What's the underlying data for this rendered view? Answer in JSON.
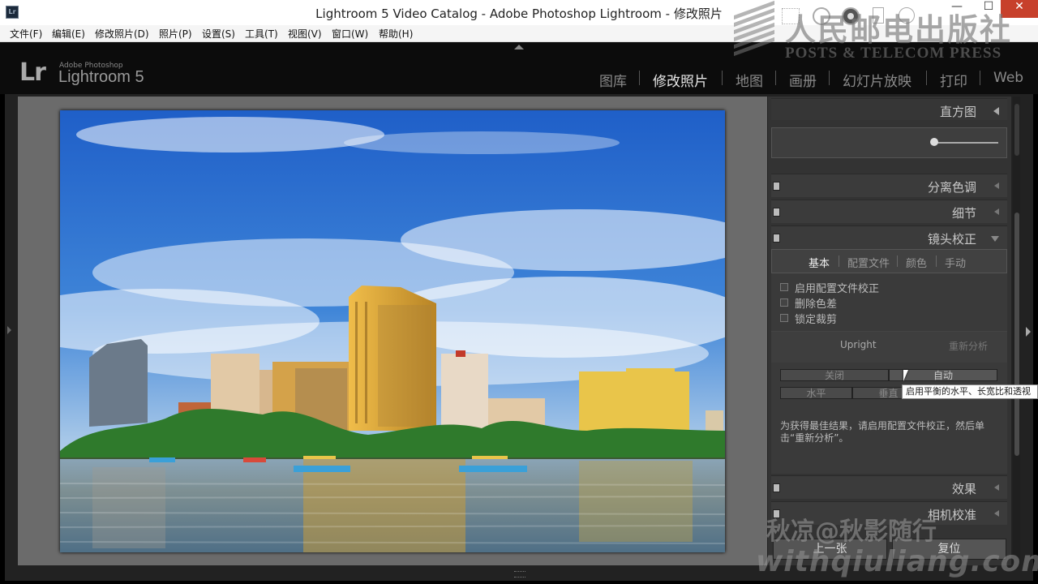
{
  "window": {
    "title": "Lightroom 5 Video Catalog - Adobe Photoshop Lightroom - 修改照片",
    "app_icon": "Lr",
    "minimize": "—",
    "maximize": "☐",
    "close": "✕"
  },
  "menu": [
    "文件(F)",
    "编辑(E)",
    "修改照片(D)",
    "照片(P)",
    "设置(S)",
    "工具(T)",
    "视图(V)",
    "窗口(W)",
    "帮助(H)"
  ],
  "header": {
    "logo": "Lr",
    "brand_small": "Adobe Photoshop",
    "brand_product": "Lightroom 5",
    "modules": [
      "图库",
      "修改照片",
      "地图",
      "画册",
      "幻灯片放映",
      "打印",
      "Web"
    ],
    "active_module": "修改照片"
  },
  "panel": {
    "histogram": "直方图",
    "split_toning": "分离色调",
    "detail": "细节",
    "lens_correction": "镜头校正",
    "lens_tabs": [
      "基本",
      "配置文件",
      "颜色",
      "手动"
    ],
    "active_tab": "基本",
    "checkboxes": [
      "启用配置文件校正",
      "删除色差",
      "锁定裁剪"
    ],
    "upright_label": "Upright",
    "reanalyze": "重新分析",
    "upright_buttons": [
      "关闭",
      "自动"
    ],
    "upright_buttons2": [
      "水平",
      "垂直"
    ],
    "tooltip": "启用平衡的水平、长宽比和透视",
    "hint": "为获得最佳结果，请启用配置文件校正，然后单击“重新分析”。",
    "effects": "效果",
    "camera_calibration": "相机校准",
    "previous": "上一张",
    "reset": "复位"
  },
  "watermarks": {
    "publisher_cn": "人民邮电出版社",
    "publisher_en": "POSTS & TELECOM PRESS",
    "author": "秋凉@秋影随行",
    "site": "withqiuliang.com"
  },
  "colors": {
    "accent_sky": "#1f5fc8",
    "building_gold": "#d9a53a",
    "panel_bg": "#333333"
  }
}
